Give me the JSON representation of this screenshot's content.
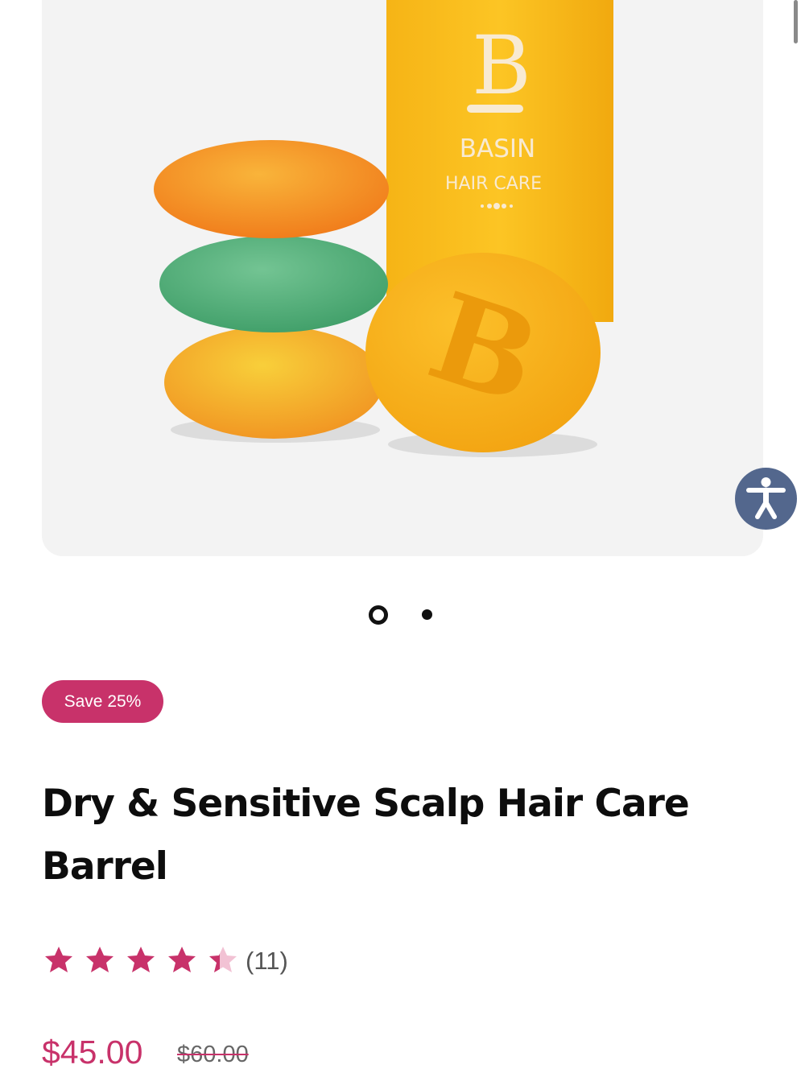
{
  "product_image": {
    "brand_name": "BASIN",
    "brand_sub": "HAIR CARE",
    "logo_letter": "B"
  },
  "carousel": {
    "slide_count": 2,
    "active_index": 0
  },
  "accessibility_button": {
    "icon": "accessibility-person-icon"
  },
  "product": {
    "badge": "Save 25%",
    "title": "Dry & Sensitive Scalp Hair Care Barrel",
    "rating": 4.8,
    "review_count": "(11)",
    "price": "$45.00",
    "compare_at_price": "$60.00"
  },
  "colors": {
    "accent": "#c8326a",
    "a11y": "#53678d",
    "image_bg": "#f3f3f3"
  }
}
